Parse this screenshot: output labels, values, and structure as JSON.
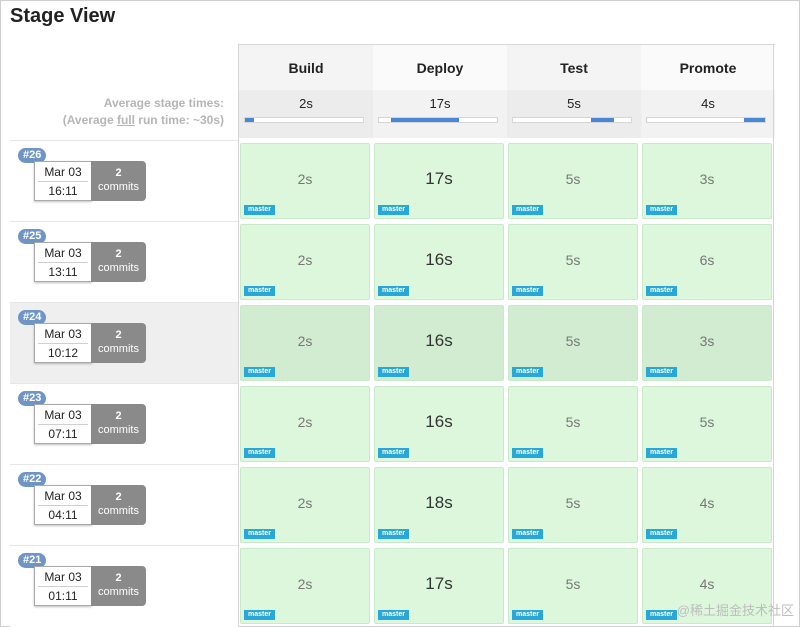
{
  "title": "Stage View",
  "avg": {
    "line1": "Average stage times:",
    "line2_prefix": "(Average ",
    "line2_u": "full",
    "line2_suffix": " run time: ~30s)"
  },
  "stages": [
    {
      "name": "Build",
      "avg": "2s",
      "fill_start": 0.0,
      "fill_len": 0.08
    },
    {
      "name": "Deploy",
      "avg": "17s",
      "fill_start": 0.1,
      "fill_len": 0.58
    },
    {
      "name": "Test",
      "avg": "5s",
      "fill_start": 0.66,
      "fill_len": 0.2
    },
    {
      "name": "Promote",
      "avg": "4s",
      "fill_start": 0.82,
      "fill_len": 0.18
    }
  ],
  "runs": [
    {
      "id": "#26",
      "date": "Mar 03",
      "time": "16:11",
      "commits_n": "2",
      "commits_label": "commits",
      "branch": "master",
      "durations": [
        "2s",
        "17s",
        "5s",
        "3s"
      ]
    },
    {
      "id": "#25",
      "date": "Mar 03",
      "time": "13:11",
      "commits_n": "2",
      "commits_label": "commits",
      "branch": "master",
      "durations": [
        "2s",
        "16s",
        "5s",
        "6s"
      ]
    },
    {
      "id": "#24",
      "date": "Mar 03",
      "time": "10:12",
      "commits_n": "2",
      "commits_label": "commits",
      "branch": "master",
      "durations": [
        "2s",
        "16s",
        "5s",
        "3s"
      ]
    },
    {
      "id": "#23",
      "date": "Mar 03",
      "time": "07:11",
      "commits_n": "2",
      "commits_label": "commits",
      "branch": "master",
      "durations": [
        "2s",
        "16s",
        "5s",
        "5s"
      ]
    },
    {
      "id": "#22",
      "date": "Mar 03",
      "time": "04:11",
      "commits_n": "2",
      "commits_label": "commits",
      "branch": "master",
      "durations": [
        "2s",
        "18s",
        "5s",
        "4s"
      ]
    },
    {
      "id": "#21",
      "date": "Mar 03",
      "time": "01:11",
      "commits_n": "2",
      "commits_label": "commits",
      "branch": "master",
      "durations": [
        "2s",
        "17s",
        "5s",
        "4s"
      ]
    }
  ],
  "watermark": "@稀土掘金技术社区"
}
